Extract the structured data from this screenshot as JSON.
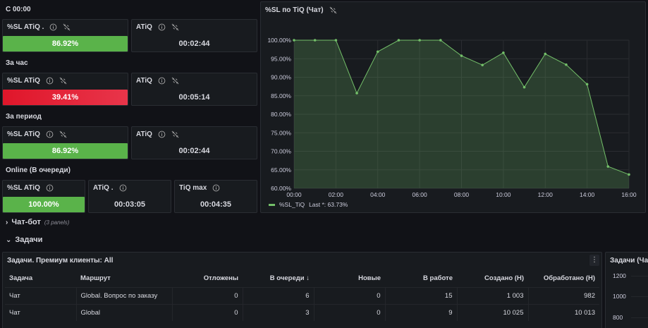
{
  "colors": {
    "green": "#5ab34a",
    "red": "#e0212f",
    "line": "#73bf69"
  },
  "sections": {
    "s1": "С 00:00",
    "s2": "За час",
    "s3": "За период",
    "s4": "Online (В очереди)"
  },
  "stats": {
    "r1_sl_title": "%SL ATiQ .",
    "r1_sl_value": "86.92%",
    "r1_atiq_title": "ATiQ",
    "r1_atiq_value": "00:02:44",
    "r2_sl_title": "%SL ATiQ",
    "r2_sl_value": "39.41%",
    "r2_atiq_title": "ATiQ",
    "r2_atiq_value": "00:05:14",
    "r3_sl_title": "%SL ATiQ",
    "r3_sl_value": "86.92%",
    "r3_atiq_title": "ATiQ",
    "r3_atiq_value": "00:02:44",
    "r4_sl_title": "%SL ATiQ",
    "r4_sl_value": "100.00%",
    "r4_atiq_title": "ATiQ .",
    "r4_atiq_value": "00:03:05",
    "r4_tiqmax_title": "TiQ max",
    "r4_tiqmax_value": "00:04:35"
  },
  "chart_panel": {
    "title": "%SL по TiQ (Чат)",
    "legend": "%SL_TiQ",
    "legend_last": "Last *: 63.73%"
  },
  "chart_data": {
    "type": "area",
    "series": [
      {
        "name": "%SL_TiQ",
        "x": [
          "00:00",
          "01:00",
          "02:00",
          "03:00",
          "04:00",
          "05:00",
          "06:00",
          "07:00",
          "08:00",
          "09:00",
          "10:00",
          "11:00",
          "12:00",
          "13:00",
          "14:00",
          "15:00",
          "16:00"
        ],
        "values": [
          100.0,
          100.0,
          100.0,
          85.7,
          96.9,
          100.0,
          100.0,
          100.0,
          95.8,
          93.3,
          96.6,
          87.3,
          96.3,
          93.4,
          88.1,
          65.9,
          63.73
        ]
      }
    ],
    "x_ticks": [
      "00:00",
      "02:00",
      "04:00",
      "06:00",
      "08:00",
      "10:00",
      "12:00",
      "14:00",
      "16:00"
    ],
    "y_ticks": [
      "60.00%",
      "65.00%",
      "70.00%",
      "75.00%",
      "80.00%",
      "85.00%",
      "90.00%",
      "95.00%",
      "100.00%"
    ],
    "ylim": [
      60,
      100
    ],
    "grid": true,
    "legend_position": "bottom-left"
  },
  "rows": {
    "chatbot_label": "Чат-бот",
    "chatbot_panels": "(3 panels)",
    "tasks_label": "Задачи"
  },
  "table_panel": {
    "title": "Задачи. Премиум клиенты: All",
    "columns": [
      "Задача",
      "Маршрут",
      "Отложены",
      "В очереди",
      "Новые",
      "В работе",
      "Создано (Н)",
      "Обработано (Н)"
    ],
    "sort_indicator": "↓",
    "rows": [
      [
        "Чат",
        "Global. Вопрос по заказу",
        "0",
        "6",
        "0",
        "15",
        "1 003",
        "982"
      ],
      [
        "Чат",
        "Global",
        "0",
        "3",
        "0",
        "9",
        "10 025",
        "10 013"
      ]
    ]
  },
  "right_panel": {
    "title": "Задачи (Чат",
    "y_ticks": [
      "1200",
      "1000",
      "800"
    ]
  }
}
